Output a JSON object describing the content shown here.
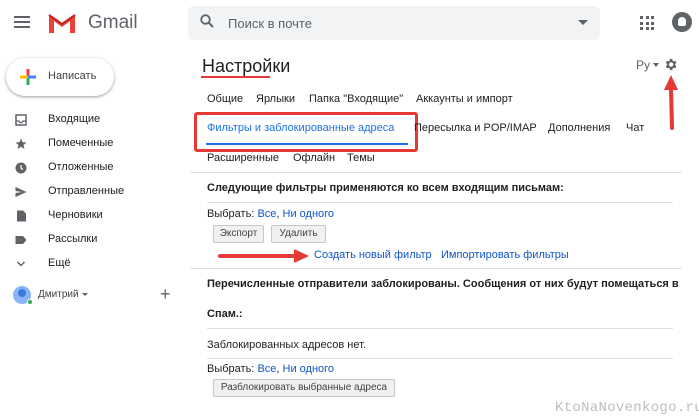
{
  "app": {
    "logo_text": "Gmail"
  },
  "search": {
    "placeholder": "Поиск в почте"
  },
  "compose": {
    "label": "Написать"
  },
  "sidebar": {
    "items": [
      {
        "label": "Входящие",
        "icon": "inbox-icon"
      },
      {
        "label": "Помеченные",
        "icon": "star-icon"
      },
      {
        "label": "Отложенные",
        "icon": "clock-icon"
      },
      {
        "label": "Отправленные",
        "icon": "send-icon"
      },
      {
        "label": "Черновики",
        "icon": "draft-icon"
      },
      {
        "label": "Рассылки",
        "icon": "label-icon"
      },
      {
        "label": "Ещё",
        "icon": "chevron-down-icon"
      }
    ],
    "user": {
      "name": "Дмитрий"
    }
  },
  "settings": {
    "title": "Настройки",
    "language": "Ру",
    "tabs_row1": [
      "Общие",
      "Ярлыки",
      "Папка \"Входящие\"",
      "Аккаунты и импорт"
    ],
    "tabs_row2": [
      "Фильтры и заблокированные адреса",
      "Пересылка и POP/IMAP",
      "Дополнения",
      "Чат"
    ],
    "tabs_row3": [
      "Расширенные",
      "Офлайн",
      "Темы"
    ],
    "active_tab": "Фильтры и заблокированные адреса"
  },
  "filters": {
    "heading": "Следующие фильтры применяются ко всем входящим письмам:",
    "select_label": "Выбрать:",
    "select_all": "Все",
    "select_none": "Ни одного",
    "export_button": "Экспорт",
    "delete_button": "Удалить",
    "create_link": "Создать новый фильтр",
    "import_link": "Импортировать фильтры"
  },
  "blocked": {
    "heading_line1": "Перечисленные отправители заблокированы. Сообщения от них будут помещаться в",
    "heading_line2": "Спам.:",
    "empty_text": "Заблокированных адресов нет.",
    "select_label": "Выбрать:",
    "select_all": "Все",
    "select_none": "Ни одного",
    "unblock_button": "Разблокировать выбранные адреса"
  },
  "colors": {
    "accent": "#1a73e8",
    "annotation": "#e53935",
    "link": "#1155cc"
  },
  "watermark": "KtoNaNovenkogo.ru"
}
